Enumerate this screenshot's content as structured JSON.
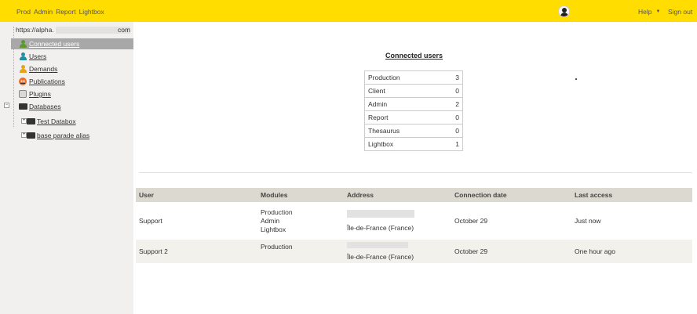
{
  "topbar": {
    "nav": [
      "Prod",
      "Admin",
      "Report",
      "Lightbox"
    ],
    "help_label": "Help",
    "help_caret": "▼",
    "signout_label": "Sign out",
    "bg_color": "#ffdd00"
  },
  "sidebar": {
    "url_prefix": "https://alpha.",
    "url_suffix": "com",
    "items": [
      {
        "label": "Connected users",
        "icon": "user-green-icon",
        "active": true
      },
      {
        "label": "Users",
        "icon": "user-teal-icon"
      },
      {
        "label": "Demands",
        "icon": "user-orange-icon"
      },
      {
        "label": "Publications",
        "icon": "publication-icon"
      },
      {
        "label": "Plugins",
        "icon": "plugin-icon"
      },
      {
        "label": "Databases",
        "icon": "database-icon"
      },
      {
        "label": "Test Databox",
        "icon": "database-icon"
      },
      {
        "label": "base parade alias",
        "icon": "database-icon"
      }
    ]
  },
  "main": {
    "title": "Connected users",
    "counts": [
      {
        "label": "Production",
        "value": "3"
      },
      {
        "label": "Client",
        "value": "0"
      },
      {
        "label": "Admin",
        "value": "2"
      },
      {
        "label": "Report",
        "value": "0"
      },
      {
        "label": "Thesaurus",
        "value": "0"
      },
      {
        "label": "Lightbox",
        "value": "1"
      }
    ],
    "table": {
      "headers": [
        "User",
        "Modules",
        "Address",
        "Connection date",
        "Last access"
      ],
      "rows": [
        {
          "user": "Support",
          "modules": [
            "Production",
            "Admin",
            "Lightbox"
          ],
          "address": "Île-de-France (France)",
          "date": "October 29",
          "last": "Just now"
        },
        {
          "user": "Support 2",
          "modules": [
            "Production"
          ],
          "address": "Île-de-France (France)",
          "date": "October 29",
          "last": "One hour ago"
        }
      ]
    }
  }
}
